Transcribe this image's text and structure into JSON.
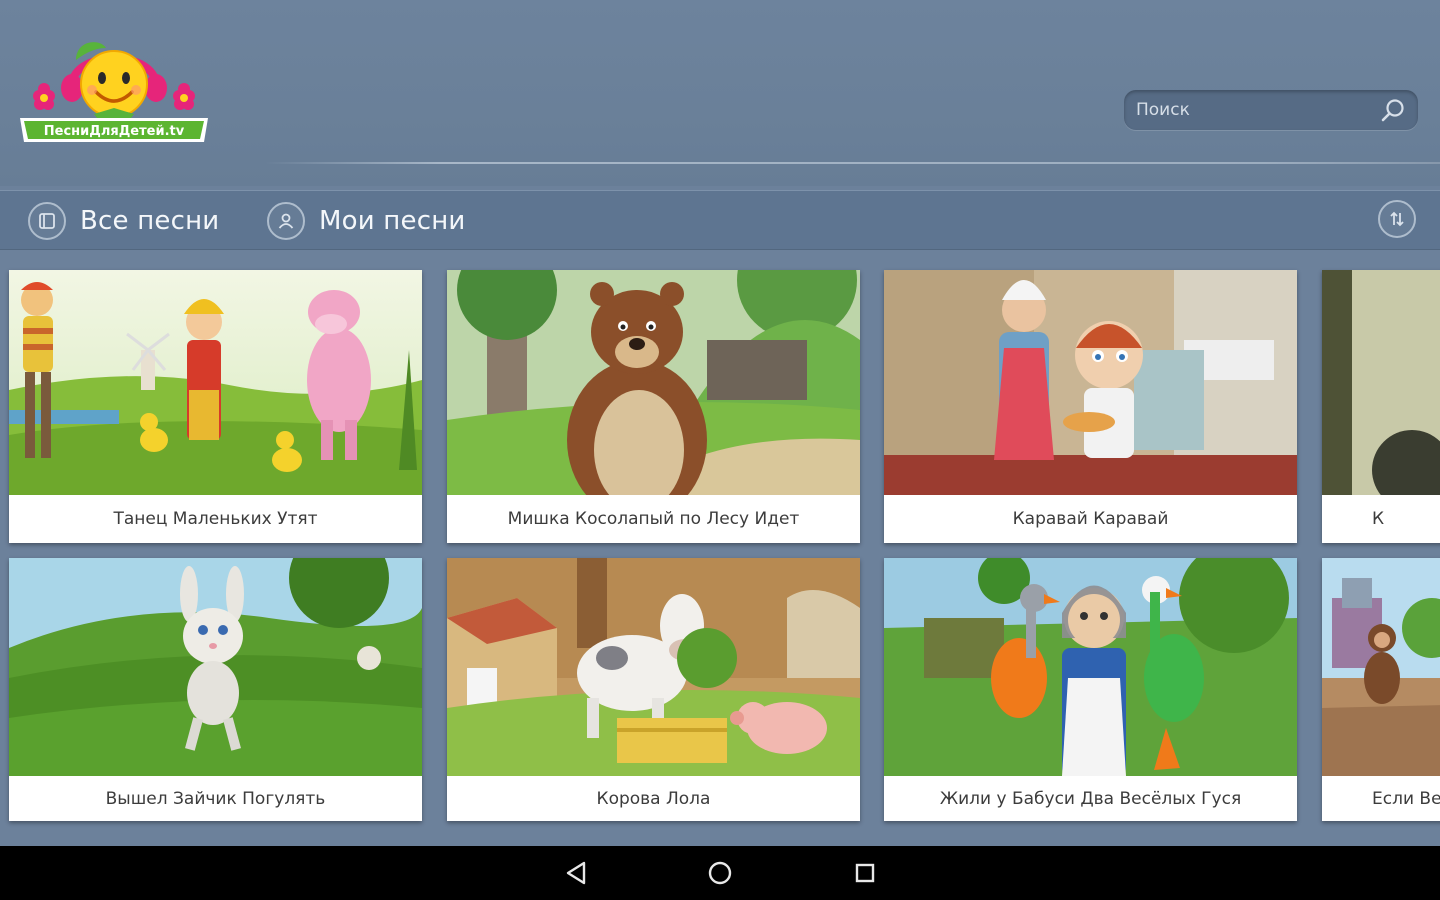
{
  "app": {
    "logo_text": "ПесниДляДетей.tv"
  },
  "search": {
    "placeholder": "Поиск",
    "icon": "search-icon"
  },
  "nav": {
    "items": [
      {
        "label": "Все песни",
        "icon": "list-icon"
      },
      {
        "label": "Мои песни",
        "icon": "user-icon"
      }
    ],
    "sort_icon": "sort-icon"
  },
  "songs": [
    {
      "title": "Танец Маленьких Утят"
    },
    {
      "title": "Мишка Косолапый по Лесу Идет"
    },
    {
      "title": "Каравай Каравай"
    },
    {
      "title": "К"
    },
    {
      "title": "Вышел Зайчик Погулять"
    },
    {
      "title": "Корова Лола"
    },
    {
      "title": "Жили у Бабуси Два Весёлых Гуся"
    },
    {
      "title": "Если Be"
    }
  ],
  "system_nav": [
    "back-icon",
    "home-icon",
    "recents-icon"
  ]
}
